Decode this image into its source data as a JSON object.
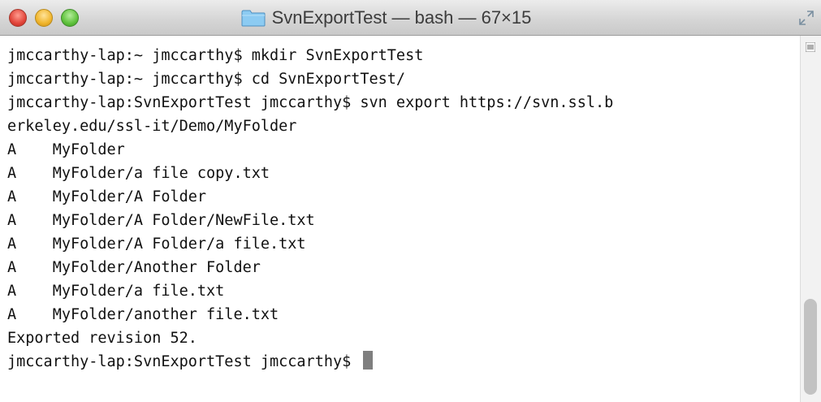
{
  "window": {
    "title": "SvnExportTest — bash — 67×15",
    "icons": {
      "close": "close-button",
      "minimize": "minimize-button",
      "zoom": "zoom-button",
      "title_folder": "folder-icon",
      "fullscreen": "fullscreen-icon"
    },
    "colors": {
      "close": "#e2453a",
      "minimize": "#f0b52c",
      "zoom": "#5fc23c",
      "folder": "#6fb7e8"
    }
  },
  "terminal": {
    "lines": [
      "jmccarthy-lap:~ jmccarthy$ mkdir SvnExportTest",
      "jmccarthy-lap:~ jmccarthy$ cd SvnExportTest/",
      "jmccarthy-lap:SvnExportTest jmccarthy$ svn export https://svn.ssl.b",
      "erkeley.edu/ssl-it/Demo/MyFolder",
      "A    MyFolder",
      "A    MyFolder/a file copy.txt",
      "A    MyFolder/A Folder",
      "A    MyFolder/A Folder/NewFile.txt",
      "A    MyFolder/A Folder/a file.txt",
      "A    MyFolder/Another Folder",
      "A    MyFolder/a file.txt",
      "A    MyFolder/another file.txt",
      "Exported revision 52."
    ],
    "prompt": "jmccarthy-lap:SvnExportTest jmccarthy$ "
  }
}
